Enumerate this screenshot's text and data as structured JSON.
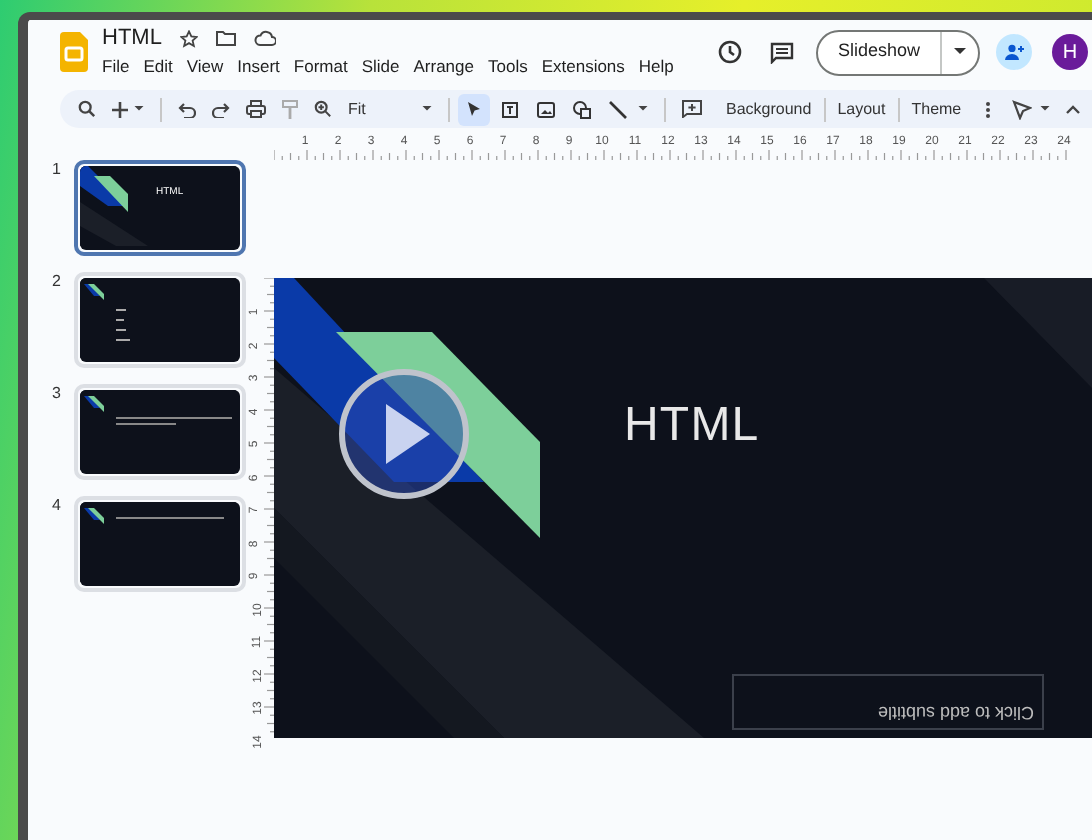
{
  "document": {
    "title": "HTML"
  },
  "menu": [
    "File",
    "Edit",
    "View",
    "Insert",
    "Format",
    "Slide",
    "Arrange",
    "Tools",
    "Extensions",
    "Help"
  ],
  "header": {
    "slideshow_button": "Slideshow",
    "avatar": "H"
  },
  "toolbar": {
    "zoom": "Fit",
    "tools": [
      {
        "kind": "select",
        "selected": true
      },
      {
        "kind": "textbox",
        "selected": false
      },
      {
        "kind": "image",
        "selected": false
      },
      {
        "kind": "shapes",
        "selected": false
      },
      {
        "kind": "line",
        "selected": false
      }
    ],
    "buttons": [
      "Background",
      "Layout",
      "Theme"
    ]
  },
  "ruler": {
    "horizontal": [
      "1",
      "2",
      "3",
      "4",
      "5",
      "6",
      "7",
      "8",
      "9",
      "10",
      "11",
      "12",
      "13",
      "14",
      "15",
      "16",
      "17",
      "18",
      "19",
      "20",
      "21",
      "22",
      "23",
      "24"
    ],
    "vertical": [
      "1",
      "2",
      "3",
      "4",
      "5",
      "6",
      "7",
      "8",
      "9",
      "10",
      "11",
      "12",
      "13",
      "14"
    ]
  },
  "slides": [
    {
      "number": "1",
      "selected": true,
      "kind": "title",
      "title": "HTML"
    },
    {
      "number": "2",
      "selected": false,
      "kind": "bullets"
    },
    {
      "number": "3",
      "selected": false,
      "kind": "paragraph"
    },
    {
      "number": "4",
      "selected": false,
      "kind": "line"
    }
  ],
  "slide": {
    "title": "HTML",
    "subtitle_placeholder": "Click to add subtitle",
    "subtitle_flipped": true
  }
}
